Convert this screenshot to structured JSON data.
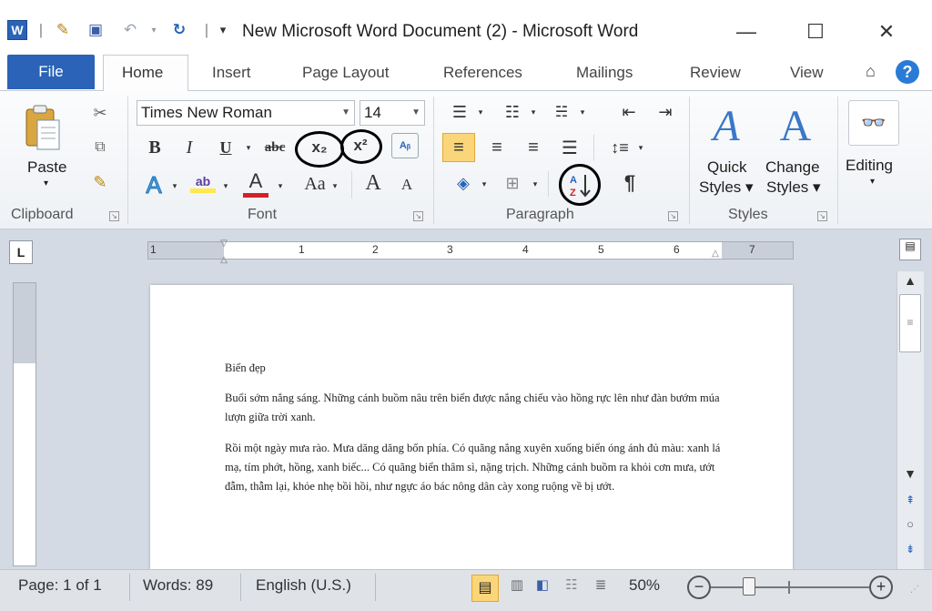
{
  "window": {
    "title": "New Microsoft Word Document (2)  -  Microsoft Word",
    "minimize": "—",
    "maximize": "☐",
    "close": "✕"
  },
  "quick_access": {
    "separator": "|",
    "customize": "▾"
  },
  "tabs": {
    "file": "File",
    "home": "Home",
    "insert": "Insert",
    "page_layout": "Page Layout",
    "references": "References",
    "mailings": "Mailings",
    "review": "Review",
    "view": "View",
    "collapse": "⌂",
    "help": "?"
  },
  "clipboard": {
    "label": "Clipboard",
    "paste": "Paste",
    "paste_arrow": "▾"
  },
  "font": {
    "label": "Font",
    "name": "Times New Roman",
    "size": "14",
    "bold": "B",
    "italic": "I",
    "underline": "U",
    "strikethrough": "abc",
    "subscript": "x₂",
    "superscript": "x²",
    "case": "Aa",
    "grow": "A",
    "shrink": "A",
    "color_glyph": "A",
    "highlight_glyph": "ab"
  },
  "paragraph": {
    "label": "Paragraph",
    "sort": "A Z",
    "pilcrow": "¶"
  },
  "styles": {
    "label": "Styles",
    "quick": "Quick",
    "quick2": "Styles ▾",
    "change": "Change",
    "change2": "Styles ▾"
  },
  "editing": {
    "label": "Editing",
    "arrow": "▾"
  },
  "ruler": {
    "tab_selector": "L",
    "numbers": [
      "1",
      "1",
      "2",
      "3",
      "4",
      "5",
      "6",
      "7"
    ]
  },
  "document": {
    "title": "Biển đẹp",
    "paragraph1": "Buổi sớm nắng sáng. Những cánh buồm nâu trên biển được nắng chiếu vào hồng rực lên như đàn bướm múa lượn giữa trời xanh.",
    "paragraph2": "Rồi một ngày mưa rào. Mưa dăng dăng bốn phía. Có quãng nắng xuyên xuống biển óng ánh đủ màu: xanh lá mạ, tím phớt, hồng, xanh biếc... Có quãng biển thâm sì, nặng trịch. Những cánh buồm ra khỏi cơn mưa, ướt đẫm, thẫm lại, khỏe nhẹ bồi hồi, như ngực áo bác nông dân cày xong ruộng về bị ướt."
  },
  "status": {
    "page": "Page: 1 of 1",
    "words": "Words: 89",
    "language": "English (U.S.)",
    "zoom": "50%",
    "zoom_out": "−",
    "zoom_in": "+",
    "zoom_level": 0.5
  },
  "colors": {
    "file_tab": "#2a63b8",
    "accent_red": "#d4202a",
    "highlight_yellow": "#ffe94d",
    "selected": "#fbd57a"
  }
}
